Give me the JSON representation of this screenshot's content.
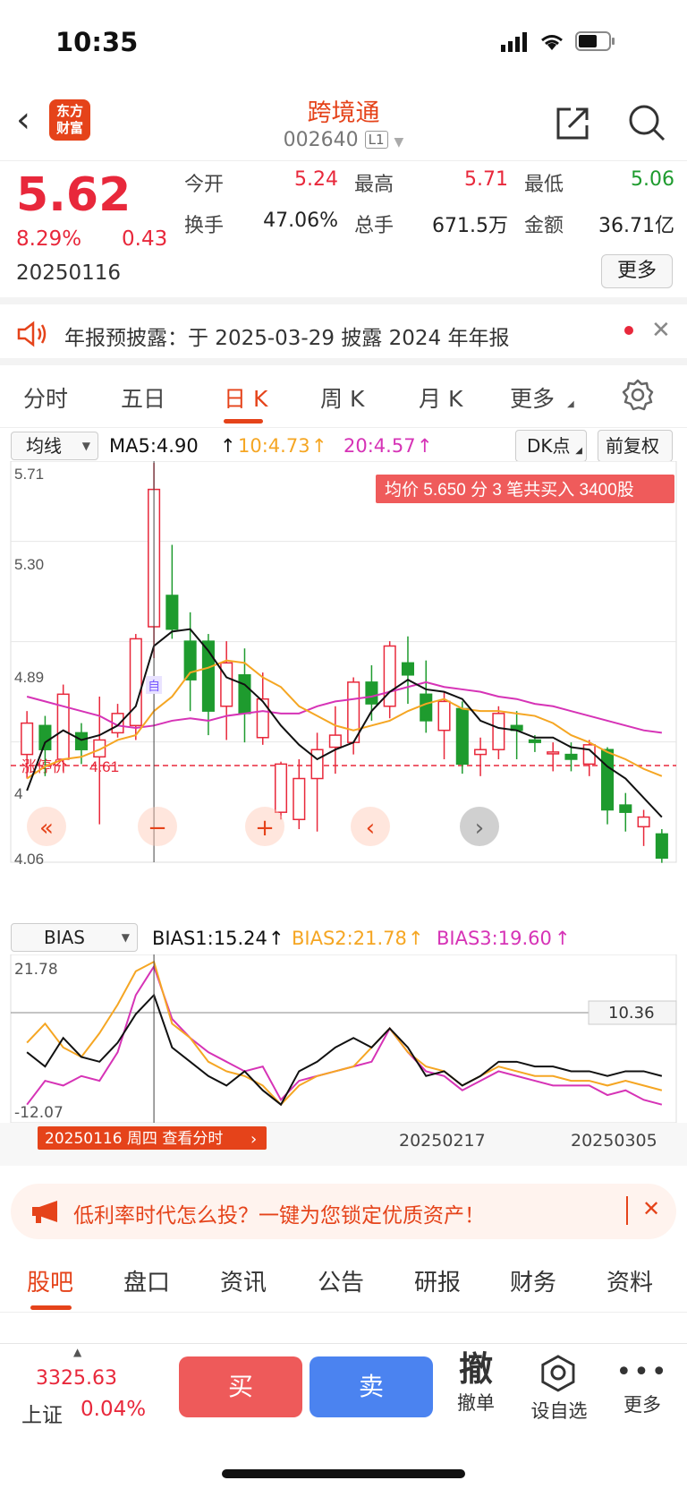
{
  "status": {
    "time": "10:35"
  },
  "header": {
    "logo_line1": "东方",
    "logo_line2": "财富",
    "title": "跨境通",
    "code": "002640",
    "badge": "L1"
  },
  "quote": {
    "price": "5.62",
    "change_pct": "8.29%",
    "change": "0.43",
    "date": "20250116",
    "labels": {
      "open": "今开",
      "high": "最高",
      "low": "最低",
      "turnover": "换手",
      "volume": "总手",
      "amount": "金额"
    },
    "values": {
      "open": "5.24",
      "high": "5.71",
      "low": "5.06",
      "turnover": "47.06%",
      "volume": "671.5万",
      "amount": "36.71亿"
    },
    "more": "更多"
  },
  "notice": {
    "text": "年报预披露：于 2025-03-29 披露 2024 年年报"
  },
  "tabs": [
    {
      "label": "分时"
    },
    {
      "label": "五日"
    },
    {
      "label": "日 K"
    },
    {
      "label": "周 K"
    },
    {
      "label": "月 K"
    },
    {
      "label": "更多"
    }
  ],
  "indicator_bar": {
    "ma_select": "均线",
    "ma5": "MA5:4.90",
    "ma10": "10:4.73",
    "ma20": "20:4.57",
    "dk": "DK点",
    "adjust": "前复权"
  },
  "kchart": {
    "y_ticks": [
      "5.71",
      "5.30",
      "4.89",
      "4",
      "4.06"
    ],
    "banner": "均价 5.650 分 3 笔共买入 3400股",
    "limit_label": "涨停价",
    "limit_value": "4.61",
    "ctrl": [
      "«",
      "−",
      "+",
      "‹",
      "›"
    ],
    "self_marker": "自"
  },
  "bias": {
    "select": "BIAS",
    "bias1": "BIAS1:15.24",
    "bias2": "BIAS2:21.78",
    "bias3": "BIAS3:19.60",
    "top": "21.78",
    "bottom": "-12.07",
    "right_value": "10.36"
  },
  "x_axis": {
    "d1": "20250217",
    "d2": "20250305",
    "tip": "20250116 周四 查看分时"
  },
  "chart_data": {
    "type": "candlestick",
    "title": "",
    "ylim": [
      4.06,
      5.71
    ],
    "grid": true,
    "candles": [
      {
        "o": 4.5,
        "c": 4.63,
        "h": 4.68,
        "l": 4.4
      },
      {
        "o": 4.62,
        "c": 4.52,
        "h": 4.66,
        "l": 4.41
      },
      {
        "o": 4.48,
        "c": 4.75,
        "h": 4.79,
        "l": 4.43
      },
      {
        "o": 4.59,
        "c": 4.52,
        "h": 4.63,
        "l": 4.46
      },
      {
        "o": 4.49,
        "c": 4.56,
        "h": 4.74,
        "l": 4.21
      },
      {
        "o": 4.59,
        "c": 4.67,
        "h": 4.71,
        "l": 4.57
      },
      {
        "o": 4.62,
        "c": 4.98,
        "h": 5.0,
        "l": 4.56
      },
      {
        "o": 5.03,
        "c": 5.6,
        "h": 5.71,
        "l": 4.9
      },
      {
        "o": 5.16,
        "c": 5.02,
        "h": 5.37,
        "l": 4.98
      },
      {
        "o": 4.97,
        "c": 4.81,
        "h": 5.09,
        "l": 4.68
      },
      {
        "o": 4.97,
        "c": 4.68,
        "h": 5.0,
        "l": 4.58
      },
      {
        "o": 4.7,
        "c": 4.88,
        "h": 4.97,
        "l": 4.56
      },
      {
        "o": 4.83,
        "c": 4.67,
        "h": 4.94,
        "l": 4.55
      },
      {
        "o": 4.57,
        "c": 4.73,
        "h": 4.84,
        "l": 4.54
      },
      {
        "o": 4.26,
        "c": 4.46,
        "h": 4.47,
        "l": 4.23
      },
      {
        "o": 4.23,
        "c": 4.4,
        "h": 4.48,
        "l": 4.19
      },
      {
        "o": 4.4,
        "c": 4.52,
        "h": 4.59,
        "l": 4.18
      },
      {
        "o": 4.53,
        "c": 4.58,
        "h": 4.7,
        "l": 4.42
      },
      {
        "o": 4.55,
        "c": 4.8,
        "h": 4.82,
        "l": 4.5
      },
      {
        "o": 4.8,
        "c": 4.71,
        "h": 4.87,
        "l": 4.64
      },
      {
        "o": 4.7,
        "c": 4.95,
        "h": 4.97,
        "l": 4.65
      },
      {
        "o": 4.88,
        "c": 4.83,
        "h": 4.99,
        "l": 4.71
      },
      {
        "o": 4.75,
        "c": 4.64,
        "h": 4.89,
        "l": 4.59
      },
      {
        "o": 4.6,
        "c": 4.72,
        "h": 4.76,
        "l": 4.48
      },
      {
        "o": 4.69,
        "c": 4.46,
        "h": 4.72,
        "l": 4.42
      },
      {
        "o": 4.5,
        "c": 4.52,
        "h": 4.57,
        "l": 4.41
      },
      {
        "o": 4.52,
        "c": 4.67,
        "h": 4.7,
        "l": 4.48
      },
      {
        "o": 4.62,
        "c": 4.6,
        "h": 4.68,
        "l": 4.48
      },
      {
        "o": 4.56,
        "c": 4.55,
        "h": 4.58,
        "l": 4.51
      },
      {
        "o": 4.51,
        "c": 4.51,
        "h": 4.55,
        "l": 4.43
      },
      {
        "o": 4.5,
        "c": 4.48,
        "h": 4.55,
        "l": 4.43
      },
      {
        "o": 4.46,
        "c": 4.54,
        "h": 4.56,
        "l": 4.41
      },
      {
        "o": 4.52,
        "c": 4.27,
        "h": 4.53,
        "l": 4.21
      },
      {
        "o": 4.29,
        "c": 4.26,
        "h": 4.34,
        "l": 4.18
      },
      {
        "o": 4.2,
        "c": 4.24,
        "h": 4.27,
        "l": 4.12
      },
      {
        "o": 4.17,
        "c": 4.07,
        "h": 4.19,
        "l": 4.05
      }
    ],
    "ma5": [
      4.35,
      4.55,
      4.6,
      4.56,
      4.58,
      4.62,
      4.7,
      4.95,
      5.01,
      5.02,
      4.93,
      4.82,
      4.79,
      4.72,
      4.62,
      4.54,
      4.48,
      4.52,
      4.55,
      4.68,
      4.76,
      4.81,
      4.77,
      4.76,
      4.73,
      4.64,
      4.61,
      4.6,
      4.57,
      4.57,
      4.53,
      4.52,
      4.45,
      4.4,
      4.32,
      4.24
    ],
    "ma10": [
      4.4,
      4.45,
      4.48,
      4.49,
      4.52,
      4.56,
      4.58,
      4.68,
      4.74,
      4.84,
      4.86,
      4.89,
      4.88,
      4.82,
      4.78,
      4.7,
      4.66,
      4.62,
      4.6,
      4.62,
      4.64,
      4.68,
      4.71,
      4.73,
      4.69,
      4.68,
      4.68,
      4.67,
      4.66,
      4.63,
      4.58,
      4.55,
      4.51,
      4.48,
      4.44,
      4.41
    ],
    "ma20": [
      4.74,
      4.72,
      4.7,
      4.68,
      4.66,
      4.62,
      4.61,
      4.62,
      4.64,
      4.65,
      4.64,
      4.66,
      4.67,
      4.68,
      4.67,
      4.67,
      4.7,
      4.72,
      4.73,
      4.74,
      4.76,
      4.78,
      4.8,
      4.78,
      4.77,
      4.76,
      4.74,
      4.73,
      4.71,
      4.7,
      4.68,
      4.66,
      4.64,
      4.62,
      4.6,
      4.59
    ],
    "bias_ylim": [
      -12.07,
      21.78
    ],
    "bias1": [
      2,
      -1,
      5,
      1,
      0,
      4,
      10,
      14,
      3,
      0,
      -3,
      -5,
      -2,
      -6,
      -9,
      -2,
      0,
      3,
      5,
      3,
      7,
      3,
      -3,
      -2,
      -5,
      -3,
      0,
      0,
      -1,
      -1,
      -2,
      -2,
      -3,
      -2,
      -2,
      -3
    ],
    "bias2": [
      4,
      8,
      3,
      1,
      6,
      12,
      19,
      21,
      8,
      5,
      0,
      -2,
      -3,
      -5,
      -9,
      -5,
      -3,
      -2,
      -1,
      3,
      7,
      2,
      -1,
      -2,
      -5,
      -3,
      -1,
      -2,
      -3,
      -3,
      -4,
      -4,
      -5,
      -4,
      -5,
      -6
    ],
    "bias3": [
      -9,
      -4,
      -5,
      -3,
      -4,
      2,
      14,
      20,
      9,
      5,
      2,
      0,
      -2,
      -1,
      -8,
      -4,
      -3,
      -2,
      -1,
      0,
      7,
      2,
      -2,
      -3,
      -6,
      -4,
      -2,
      -3,
      -4,
      -5,
      -5,
      -5,
      -7,
      -6,
      -8,
      -9
    ]
  },
  "ad": {
    "text": "低利率时代怎么投？一键为您锁定优质资产！"
  },
  "bottom_tabs": [
    {
      "label": "股吧"
    },
    {
      "label": "盘口"
    },
    {
      "label": "资讯"
    },
    {
      "label": "公告"
    },
    {
      "label": "研报"
    },
    {
      "label": "财务"
    },
    {
      "label": "资料"
    }
  ],
  "bottom": {
    "index_value": "3325.63",
    "index_name": "上证",
    "index_pct": "0.04%",
    "buy": "买",
    "sell": "卖",
    "cancel_icon": "撤",
    "cancel": "撤单",
    "add_fav": "设自选",
    "more": "更多"
  },
  "colors": {
    "up": "#e8283b",
    "down": "#1e9b2e",
    "brand": "#e5431a",
    "ma10": "#f5a623",
    "ma20": "#d633b6"
  }
}
